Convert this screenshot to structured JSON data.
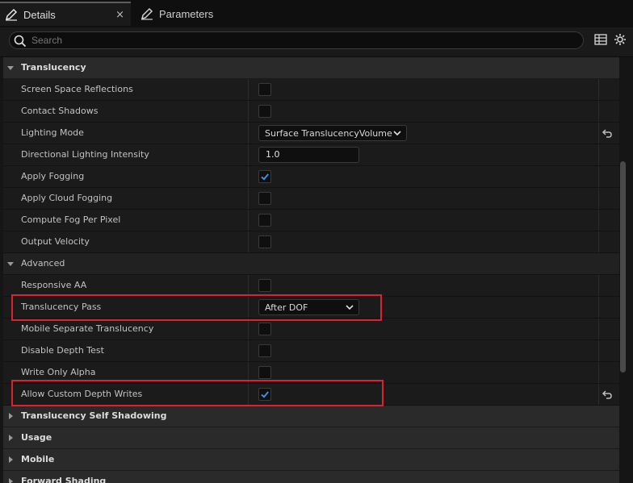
{
  "tabs": [
    {
      "label": "Details",
      "icon": "pencil-icon",
      "close": "×"
    },
    {
      "label": "Parameters",
      "icon": "pencil-icon"
    }
  ],
  "search": {
    "placeholder": "Search",
    "value": ""
  },
  "toolbar_icons": [
    "table-view-icon",
    "settings-gear-icon"
  ],
  "categories": {
    "translucency": "Translucency",
    "advanced": "Advanced",
    "self_shadowing": "Translucency Self Shadowing",
    "usage": "Usage",
    "mobile": "Mobile",
    "forward_shading": "Forward Shading"
  },
  "properties": {
    "ssr": {
      "label": "Screen Space Reflections",
      "checked": false
    },
    "contact_shadows": {
      "label": "Contact Shadows",
      "checked": false
    },
    "lighting_mode": {
      "label": "Lighting Mode",
      "value": "Surface TranslucencyVolume"
    },
    "dir_light_intensity": {
      "label": "Directional Lighting Intensity",
      "value": "1.0"
    },
    "apply_fogging": {
      "label": "Apply Fogging",
      "checked": true
    },
    "apply_cloud_fogging": {
      "label": "Apply Cloud Fogging",
      "checked": false
    },
    "compute_fog_per_pixel": {
      "label": "Compute Fog Per Pixel",
      "checked": false
    },
    "output_velocity": {
      "label": "Output Velocity",
      "checked": false
    },
    "responsive_aa": {
      "label": "Responsive AA",
      "checked": false
    },
    "translucency_pass": {
      "label": "Translucency Pass",
      "value": "After DOF"
    },
    "mobile_separate": {
      "label": "Mobile Separate Translucency",
      "checked": false
    },
    "disable_depth_test": {
      "label": "Disable Depth Test",
      "checked": false
    },
    "write_only_alpha": {
      "label": "Write Only Alpha",
      "checked": false
    },
    "allow_custom_depth": {
      "label": "Allow Custom Depth Writes",
      "checked": true
    }
  },
  "colors": {
    "accent_check": "#3b8fe0",
    "highlight_box": "#d9232e",
    "panel_bg": "#1b1b1b",
    "category_bg": "#2a2a2a"
  }
}
